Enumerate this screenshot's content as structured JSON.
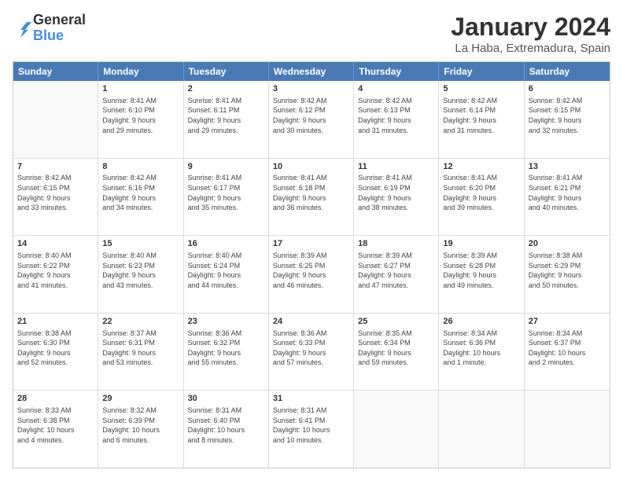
{
  "logo": {
    "general": "General",
    "blue": "Blue"
  },
  "title": "January 2024",
  "location": "La Haba, Extremadura, Spain",
  "header_days": [
    "Sunday",
    "Monday",
    "Tuesday",
    "Wednesday",
    "Thursday",
    "Friday",
    "Saturday"
  ],
  "weeks": [
    [
      {
        "day": "",
        "info": ""
      },
      {
        "day": "1",
        "info": "Sunrise: 8:41 AM\nSunset: 6:10 PM\nDaylight: 9 hours\nand 29 minutes."
      },
      {
        "day": "2",
        "info": "Sunrise: 8:41 AM\nSunset: 6:11 PM\nDaylight: 9 hours\nand 29 minutes."
      },
      {
        "day": "3",
        "info": "Sunrise: 8:42 AM\nSunset: 6:12 PM\nDaylight: 9 hours\nand 30 minutes."
      },
      {
        "day": "4",
        "info": "Sunrise: 8:42 AM\nSunset: 6:13 PM\nDaylight: 9 hours\nand 31 minutes."
      },
      {
        "day": "5",
        "info": "Sunrise: 8:42 AM\nSunset: 6:14 PM\nDaylight: 9 hours\nand 31 minutes."
      },
      {
        "day": "6",
        "info": "Sunrise: 8:42 AM\nSunset: 6:15 PM\nDaylight: 9 hours\nand 32 minutes."
      }
    ],
    [
      {
        "day": "7",
        "info": "Sunrise: 8:42 AM\nSunset: 6:15 PM\nDaylight: 9 hours\nand 33 minutes."
      },
      {
        "day": "8",
        "info": "Sunrise: 8:42 AM\nSunset: 6:16 PM\nDaylight: 9 hours\nand 34 minutes."
      },
      {
        "day": "9",
        "info": "Sunrise: 8:41 AM\nSunset: 6:17 PM\nDaylight: 9 hours\nand 35 minutes."
      },
      {
        "day": "10",
        "info": "Sunrise: 8:41 AM\nSunset: 6:18 PM\nDaylight: 9 hours\nand 36 minutes."
      },
      {
        "day": "11",
        "info": "Sunrise: 8:41 AM\nSunset: 6:19 PM\nDaylight: 9 hours\nand 38 minutes."
      },
      {
        "day": "12",
        "info": "Sunrise: 8:41 AM\nSunset: 6:20 PM\nDaylight: 9 hours\nand 39 minutes."
      },
      {
        "day": "13",
        "info": "Sunrise: 8:41 AM\nSunset: 6:21 PM\nDaylight: 9 hours\nand 40 minutes."
      }
    ],
    [
      {
        "day": "14",
        "info": "Sunrise: 8:40 AM\nSunset: 6:22 PM\nDaylight: 9 hours\nand 41 minutes."
      },
      {
        "day": "15",
        "info": "Sunrise: 8:40 AM\nSunset: 6:23 PM\nDaylight: 9 hours\nand 43 minutes."
      },
      {
        "day": "16",
        "info": "Sunrise: 8:40 AM\nSunset: 6:24 PM\nDaylight: 9 hours\nand 44 minutes."
      },
      {
        "day": "17",
        "info": "Sunrise: 8:39 AM\nSunset: 6:25 PM\nDaylight: 9 hours\nand 46 minutes."
      },
      {
        "day": "18",
        "info": "Sunrise: 8:39 AM\nSunset: 6:27 PM\nDaylight: 9 hours\nand 47 minutes."
      },
      {
        "day": "19",
        "info": "Sunrise: 8:39 AM\nSunset: 6:28 PM\nDaylight: 9 hours\nand 49 minutes."
      },
      {
        "day": "20",
        "info": "Sunrise: 8:38 AM\nSunset: 6:29 PM\nDaylight: 9 hours\nand 50 minutes."
      }
    ],
    [
      {
        "day": "21",
        "info": "Sunrise: 8:38 AM\nSunset: 6:30 PM\nDaylight: 9 hours\nand 52 minutes."
      },
      {
        "day": "22",
        "info": "Sunrise: 8:37 AM\nSunset: 6:31 PM\nDaylight: 9 hours\nand 53 minutes."
      },
      {
        "day": "23",
        "info": "Sunrise: 8:36 AM\nSunset: 6:32 PM\nDaylight: 9 hours\nand 55 minutes."
      },
      {
        "day": "24",
        "info": "Sunrise: 8:36 AM\nSunset: 6:33 PM\nDaylight: 9 hours\nand 57 minutes."
      },
      {
        "day": "25",
        "info": "Sunrise: 8:35 AM\nSunset: 6:34 PM\nDaylight: 9 hours\nand 59 minutes."
      },
      {
        "day": "26",
        "info": "Sunrise: 8:34 AM\nSunset: 6:36 PM\nDaylight: 10 hours\nand 1 minute."
      },
      {
        "day": "27",
        "info": "Sunrise: 8:34 AM\nSunset: 6:37 PM\nDaylight: 10 hours\nand 2 minutes."
      }
    ],
    [
      {
        "day": "28",
        "info": "Sunrise: 8:33 AM\nSunset: 6:38 PM\nDaylight: 10 hours\nand 4 minutes."
      },
      {
        "day": "29",
        "info": "Sunrise: 8:32 AM\nSunset: 6:39 PM\nDaylight: 10 hours\nand 6 minutes."
      },
      {
        "day": "30",
        "info": "Sunrise: 8:31 AM\nSunset: 6:40 PM\nDaylight: 10 hours\nand 8 minutes."
      },
      {
        "day": "31",
        "info": "Sunrise: 8:31 AM\nSunset: 6:41 PM\nDaylight: 10 hours\nand 10 minutes."
      },
      {
        "day": "",
        "info": ""
      },
      {
        "day": "",
        "info": ""
      },
      {
        "day": "",
        "info": ""
      }
    ]
  ]
}
